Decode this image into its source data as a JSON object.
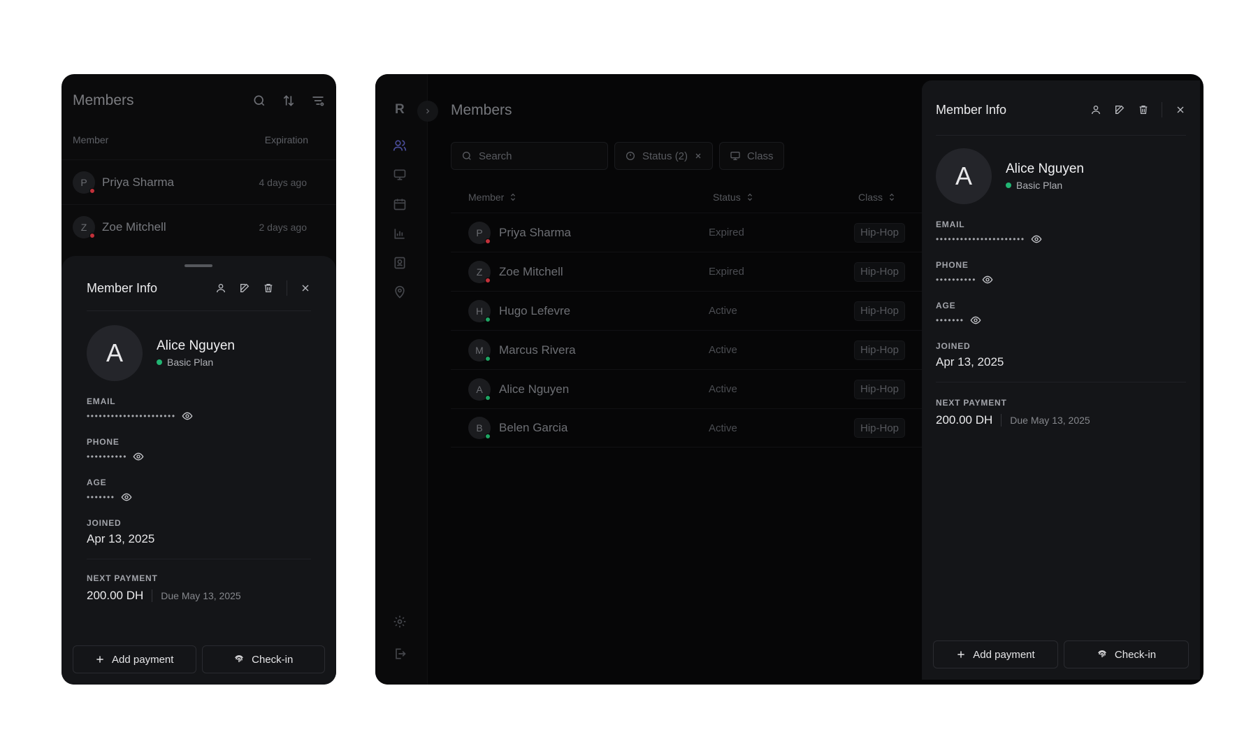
{
  "mobile": {
    "title": "Members",
    "columns": {
      "member": "Member",
      "expiration": "Expiration"
    },
    "rows": [
      {
        "initial": "P",
        "name": "Priya Sharma",
        "expiration": "4 days ago",
        "status_color": "#c2313a"
      },
      {
        "initial": "Z",
        "name": "Zoe Mitchell",
        "expiration": "2 days ago",
        "status_color": "#c2313a"
      }
    ]
  },
  "desktop": {
    "logo": "R",
    "title": "Members",
    "search": {
      "placeholder": "Search"
    },
    "filters": {
      "status": "Status (2)",
      "class": "Class"
    },
    "columns": {
      "member": "Member",
      "status": "Status",
      "class": "Class"
    },
    "rows": [
      {
        "initial": "P",
        "name": "Priya Sharma",
        "status": "Expired",
        "class": "Hip-Hop",
        "status_color": "#c2313a"
      },
      {
        "initial": "Z",
        "name": "Zoe Mitchell",
        "status": "Expired",
        "class": "Hip-Hop",
        "status_color": "#c2313a"
      },
      {
        "initial": "H",
        "name": "Hugo Lefevre",
        "status": "Active",
        "class": "Hip-Hop",
        "status_color": "#1fa463"
      },
      {
        "initial": "M",
        "name": "Marcus Rivera",
        "status": "Active",
        "class": "Hip-Hop",
        "status_color": "#1fa463"
      },
      {
        "initial": "A",
        "name": "Alice Nguyen",
        "status": "Active",
        "class": "Hip-Hop",
        "status_color": "#1fa463"
      },
      {
        "initial": "B",
        "name": "Belen Garcia",
        "status": "Active",
        "class": "Hip-Hop",
        "status_color": "#1fa463"
      }
    ]
  },
  "member_info": {
    "title": "Member Info",
    "initial": "A",
    "name": "Alice Nguyen",
    "plan": "Basic Plan",
    "email": {
      "label": "EMAIL",
      "masked": "••••••••••••••••••••••"
    },
    "phone": {
      "label": "PHONE",
      "masked": "••••••••••"
    },
    "age": {
      "label": "AGE",
      "masked": "•••••••"
    },
    "joined": {
      "label": "JOINED",
      "value": "Apr 13, 2025"
    },
    "next_payment": {
      "label": "NEXT PAYMENT",
      "amount": "200.00 DH",
      "due": "Due May 13, 2025"
    },
    "actions": {
      "add_payment": "Add payment",
      "check_in": "Check-in"
    }
  },
  "colors": {
    "active": "#22b573",
    "expired": "#c2313a",
    "background": "#141518"
  }
}
